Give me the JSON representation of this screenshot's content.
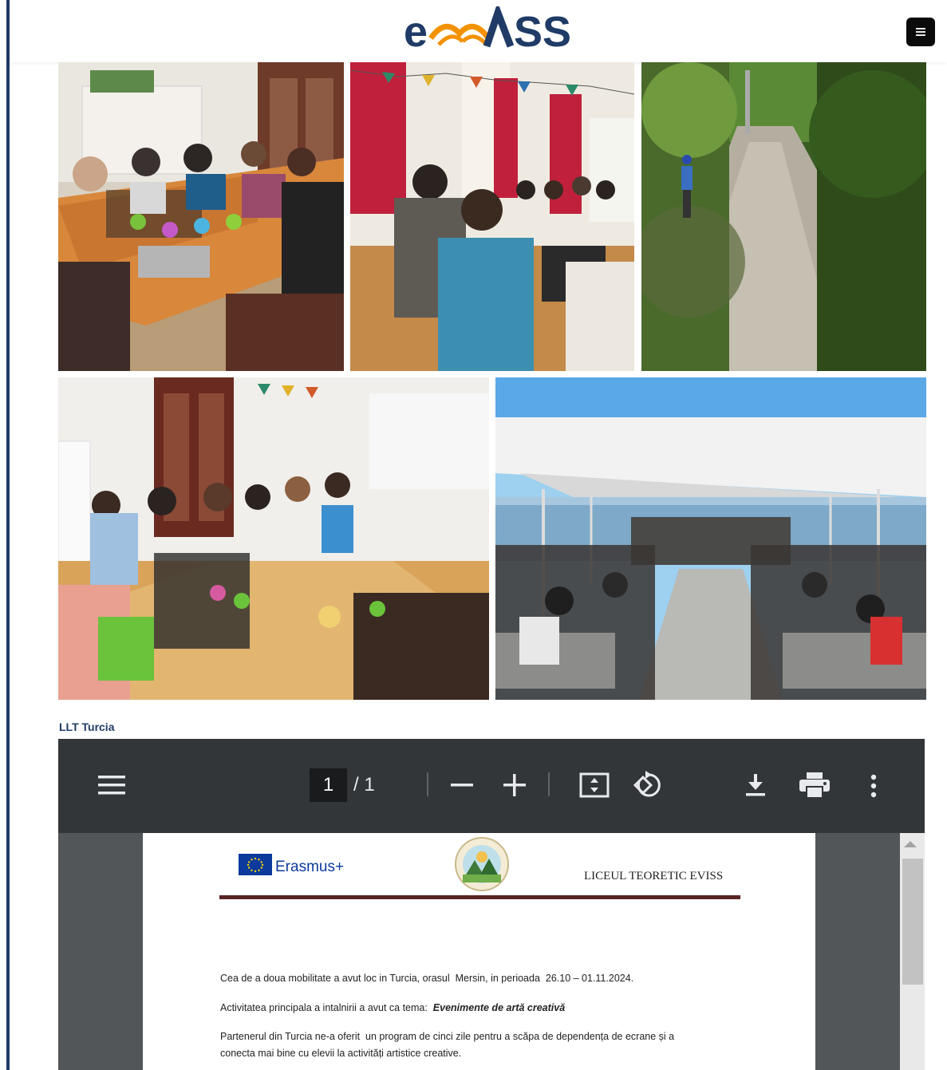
{
  "header": {
    "logo_text": "eviss",
    "menu_button": "menu-icon"
  },
  "gallery": {
    "photos": [
      {
        "alt": "meeting-room-1"
      },
      {
        "alt": "meeting-room-2"
      },
      {
        "alt": "forest-path"
      },
      {
        "alt": "meeting-room-3"
      },
      {
        "alt": "ferry-deck"
      }
    ]
  },
  "section": {
    "caption": "LLT Turcia"
  },
  "pdf_viewer": {
    "page_current": "1",
    "page_total": "/ 1",
    "icons": {
      "menu": "hamburger-icon",
      "zoom_out": "minus-icon",
      "zoom_in": "plus-icon",
      "fit": "fit-page-icon",
      "rotate": "rotate-icon",
      "download": "download-icon",
      "print": "print-icon",
      "more": "more-vert-icon"
    },
    "document": {
      "erasmus": "Erasmus+",
      "school": "LICEUL TEORETIC EVISS",
      "p1": "Cea de a doua mobilitate a avut loc in Turcia, orasul  Mersin, in perioada  26.10 – 01.11.2024.",
      "p2_prefix": "Activitatea principala a intalnirii a avut ca tema:  ",
      "p2_theme": "Evenimente de artă creativă",
      "p3_line1": "Partenerul din Turcia ne-a oferit  un program de cinci zile pentru a scăpa de dependența de ecrane și a",
      "p3_line2": "conecta mai bine cu elevii la activități artistice creative."
    }
  },
  "colors": {
    "brand_navy": "#1f3b66",
    "brand_orange": "#f39200",
    "toolbar": "#323639",
    "viewer_bg": "#525659"
  }
}
